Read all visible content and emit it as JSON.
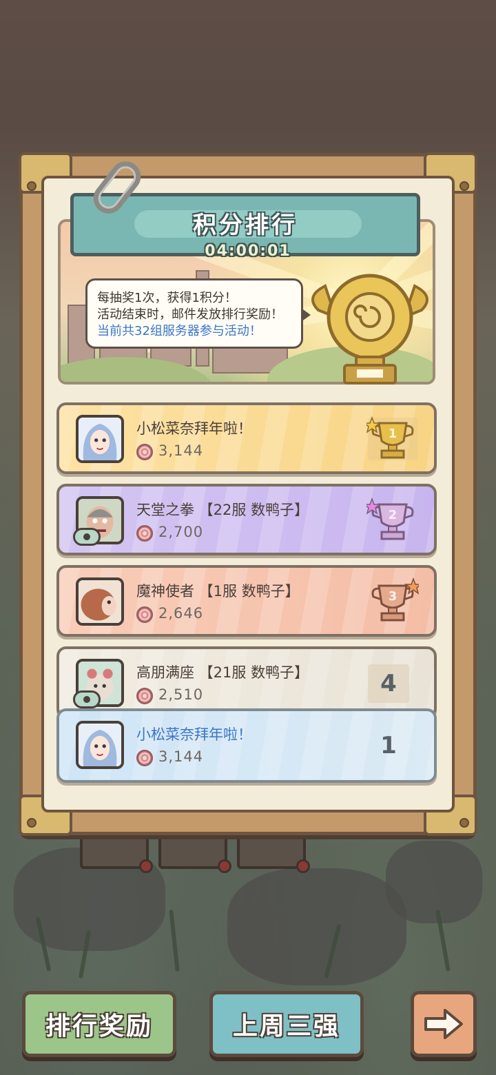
{
  "header": {
    "title": "积分排行",
    "countdown": "04:00:01"
  },
  "info": {
    "line1": "每抽奖1次，获得1积分！",
    "line2": "活动结束时，邮件发放排行奖励！",
    "line3": "当前共32组服务器参与活动！"
  },
  "ranking": [
    {
      "name": "小松菜奈拜年啦！",
      "score": "3,144",
      "rank": "1"
    },
    {
      "name": "天堂之拳 【22服 数鸭子】",
      "score": "2,700",
      "rank": "2"
    },
    {
      "name": "魔神使者 【1服 数鸭子】",
      "score": "2,646",
      "rank": "3"
    },
    {
      "name": "高朋满座 【21服 数鸭子】",
      "score": "2,510",
      "rank": "4"
    }
  ],
  "self": {
    "name": "小松菜奈拜年啦！",
    "score": "3,144",
    "rank": "1"
  },
  "buttons": {
    "rewards": "排行奖励",
    "last_week": "上周三强"
  },
  "colors": {
    "gold_row": "#fde2a5",
    "purple_row": "#d3c5f2",
    "bronze_row": "#f9cdb9",
    "self_row": "#cfe5f6",
    "self_name": "#3b76c9"
  },
  "icons": {
    "currency": "spiral-coin-icon",
    "next": "arrow-right-icon"
  }
}
